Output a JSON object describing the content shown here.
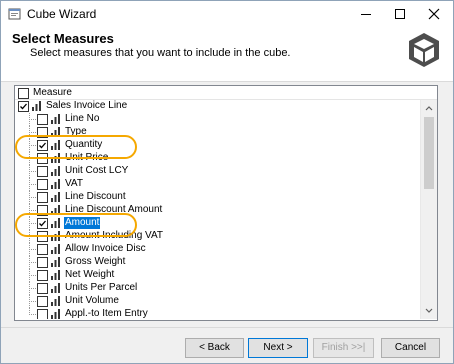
{
  "window": {
    "title": "Cube Wizard",
    "icon": "cube-wizard-icon",
    "controls": [
      "minimize-icon",
      "maximize-icon",
      "close-icon"
    ]
  },
  "header": {
    "title": "Select Measures",
    "subtitle": "Select measures that you want to include in the cube.",
    "logo": "cube-icon"
  },
  "measures": {
    "column_header": "Measure",
    "root": {
      "label": "Sales Invoice Line",
      "checked": true
    },
    "items": [
      {
        "label": "Line No",
        "checked": false
      },
      {
        "label": "Type",
        "checked": false
      },
      {
        "label": "Quantity",
        "checked": true
      },
      {
        "label": "Unit Price",
        "checked": false
      },
      {
        "label": "Unit Cost LCY",
        "checked": false
      },
      {
        "label": "VAT",
        "checked": false
      },
      {
        "label": "Line Discount",
        "checked": false
      },
      {
        "label": "Line Discount Amount",
        "checked": false
      },
      {
        "label": "Amount",
        "checked": true,
        "selected": true
      },
      {
        "label": "Amount Including VAT",
        "checked": false
      },
      {
        "label": "Allow Invoice Disc",
        "checked": false
      },
      {
        "label": "Gross Weight",
        "checked": false
      },
      {
        "label": "Net Weight",
        "checked": false
      },
      {
        "label": "Units Per Parcel",
        "checked": false
      },
      {
        "label": "Unit Volume",
        "checked": false
      },
      {
        "label": "Appl.-to Item Entry",
        "checked": false
      }
    ]
  },
  "buttons": {
    "back": "< Back",
    "next": "Next >",
    "finish": "Finish >>|",
    "cancel": "Cancel"
  },
  "colors": {
    "selection": "#0078d7",
    "annotation": "#f5a800"
  }
}
